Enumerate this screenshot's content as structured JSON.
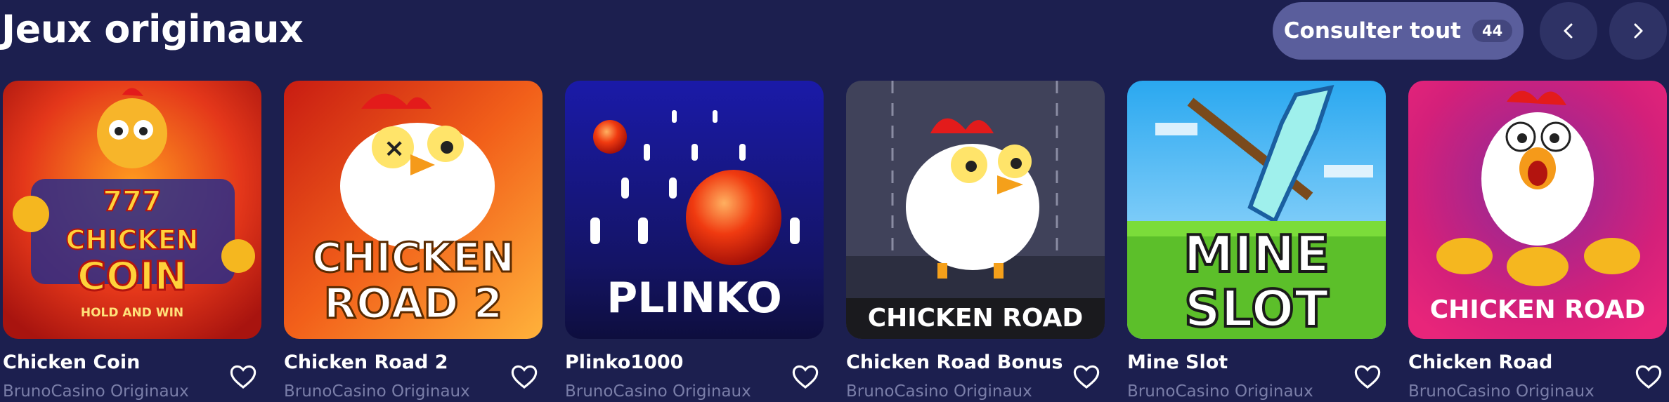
{
  "section": {
    "title": "Jeux originaux",
    "view_all_label": "Consulter tout",
    "view_all_count": "44"
  },
  "icons": {
    "prev": "chevron-left-icon",
    "next": "chevron-right-icon",
    "favorite": "heart-icon"
  },
  "games": [
    {
      "name": "Chicken Coin",
      "provider": "BrunoCasino Originaux",
      "art_lines": [
        "777",
        "CHICKEN",
        "COIN",
        "HOLD AND WIN"
      ]
    },
    {
      "name": "Chicken Road 2",
      "provider": "BrunoCasino Originaux",
      "art_lines": [
        "CHICKEN",
        "ROAD 2"
      ]
    },
    {
      "name": "Plinko1000",
      "provider": "BrunoCasino Originaux",
      "art_lines": [
        "PLINKO"
      ]
    },
    {
      "name": "Chicken Road Bonus",
      "provider": "BrunoCasino Originaux",
      "art_lines": [
        "CHICKEN ROAD"
      ]
    },
    {
      "name": "Mine Slot",
      "provider": "BrunoCasino Originaux",
      "art_lines": [
        "MINE",
        "SLOT"
      ]
    },
    {
      "name": "Chicken Road",
      "provider": "BrunoCasino Originaux",
      "art_lines": [
        "CHICKEN ROAD"
      ]
    }
  ],
  "colors": {
    "background": "#1c1f4f",
    "button": "#5a5e9c",
    "nav_button": "#2e3265",
    "provider_text": "#7a7ea8"
  }
}
